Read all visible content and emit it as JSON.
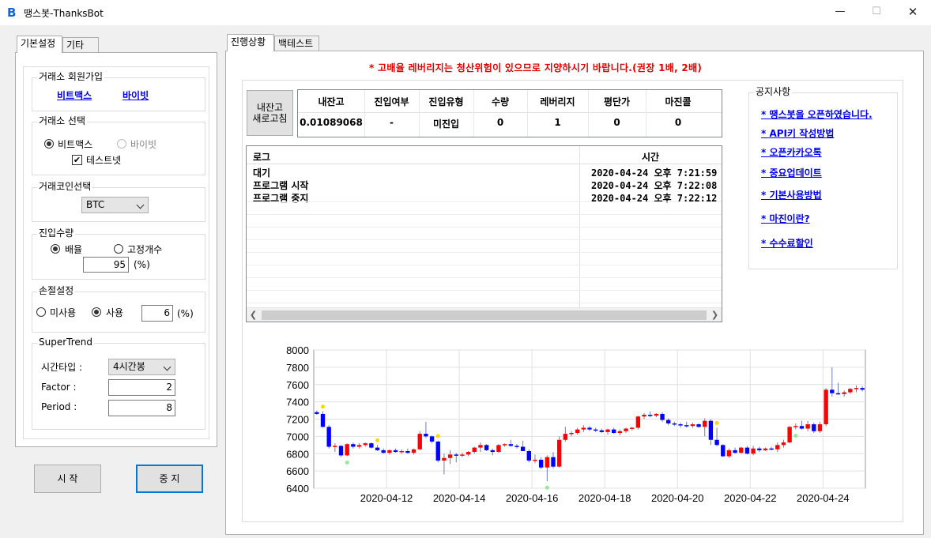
{
  "window": {
    "title": "땡스봇-ThanksBot",
    "icon": "b-logo-icon"
  },
  "left_tabs": [
    "기본설정",
    "기타"
  ],
  "signup": {
    "title": "거래소 회원가입",
    "link1": "비트맥스",
    "link2": "바이빗"
  },
  "exchange": {
    "title": "거래소 선택",
    "opt1": "비트맥스",
    "opt2": "바이빗",
    "testnet": "테스트넷",
    "selected": "비트맥스",
    "testnet_checked": true
  },
  "coin": {
    "title": "거래코인선택",
    "value": "BTC"
  },
  "qty": {
    "title": "진입수량",
    "opt1": "배율",
    "opt2": "고정개수",
    "value": "95",
    "unit": "(%)",
    "selected": "배율"
  },
  "stoploss": {
    "title": "손절설정",
    "opt1": "미사용",
    "opt2": "사용",
    "value": "6",
    "unit": "(%)",
    "selected": "사용"
  },
  "supertrend": {
    "title": "SuperTrend",
    "timeframe_label": "시간타입 :",
    "timeframe_value": "4시간봉",
    "factor_label": "Factor :",
    "factor_value": "2",
    "period_label": "Period :",
    "period_value": "8"
  },
  "buttons": {
    "start": "시 작",
    "stop": "중 지"
  },
  "right_tabs": [
    "진행상황",
    "백테스트"
  ],
  "warning": "* 고배율 레버리지는 청산위험이 있으므로 지양하시기 바랍니다.(권장 1배, 2배)",
  "refresh_button": "내잔고\n새로고침",
  "status_table": {
    "headers": [
      "내잔고",
      "진입여부",
      "진입유형",
      "수량",
      "레버리지",
      "평단가",
      "마진콜"
    ],
    "values": [
      "0.01089068",
      "-",
      "미진입",
      "0",
      "1",
      "0",
      "0"
    ]
  },
  "log": {
    "headers": [
      "로그",
      "시간"
    ],
    "rows": [
      [
        "대기",
        "2020-04-24 오후 7:21:59"
      ],
      [
        "프로그램 시작",
        "2020-04-24 오후 7:22:08"
      ],
      [
        "프로그램 중지",
        "2020-04-24 오후 7:22:12"
      ]
    ]
  },
  "notices": {
    "title": "공지사항",
    "items": [
      "* 땡스봇을 오픈하였습니다.",
      "* API키 작성방법",
      "* 오픈카카오톡",
      "* 중요업데이트",
      "* 기본사용방법",
      "* 마진이란?",
      "* 수수료할인"
    ]
  },
  "colors": {
    "up": "#ff0000",
    "down": "#0000ff",
    "buy_marker": "#90ee90",
    "sell_marker": "#ffd700",
    "link": "#0000ee",
    "warning": "#e00000"
  },
  "chart_data": {
    "type": "candlestick",
    "ylim": [
      6400,
      8000
    ],
    "yticks": [
      6400,
      6600,
      6800,
      7000,
      7200,
      7400,
      7600,
      7800,
      8000
    ],
    "xticks": [
      "2020-04-12",
      "2020-04-14",
      "2020-04-16",
      "2020-04-18",
      "2020-04-20",
      "2020-04-22",
      "2020-04-24"
    ],
    "x_start": "2020-04-10T00:00",
    "interval_hours": 4,
    "grid": true,
    "candles": [
      [
        7280,
        7300,
        7250,
        7260
      ],
      [
        7260,
        7290,
        7100,
        7110
      ],
      [
        7110,
        7130,
        6860,
        6880
      ],
      [
        6880,
        6920,
        6820,
        6890
      ],
      [
        6890,
        6900,
        6760,
        6780
      ],
      [
        6780,
        6920,
        6770,
        6910
      ],
      [
        6910,
        6930,
        6860,
        6880
      ],
      [
        6880,
        6920,
        6860,
        6900
      ],
      [
        6900,
        6930,
        6880,
        6920
      ],
      [
        6920,
        6930,
        6860,
        6870
      ],
      [
        6870,
        6900,
        6830,
        6840
      ],
      [
        6840,
        6860,
        6800,
        6810
      ],
      [
        6810,
        6850,
        6790,
        6840
      ],
      [
        6840,
        6860,
        6810,
        6820
      ],
      [
        6820,
        6850,
        6800,
        6830
      ],
      [
        6830,
        6860,
        6800,
        6810
      ],
      [
        6810,
        6860,
        6790,
        6850
      ],
      [
        6850,
        7060,
        6840,
        7030
      ],
      [
        7030,
        7170,
        6980,
        7000
      ],
      [
        7000,
        7010,
        6920,
        6940
      ],
      [
        6940,
        6950,
        6700,
        6720
      ],
      [
        6720,
        6800,
        6560,
        6750
      ],
      [
        6750,
        6840,
        6680,
        6790
      ],
      [
        6790,
        6810,
        6700,
        6780
      ],
      [
        6780,
        6810,
        6760,
        6790
      ],
      [
        6790,
        6830,
        6770,
        6820
      ],
      [
        6820,
        6880,
        6800,
        6870
      ],
      [
        6870,
        6930,
        6820,
        6900
      ],
      [
        6900,
        6910,
        6830,
        6840
      ],
      [
        6840,
        6860,
        6780,
        6820
      ],
      [
        6820,
        6910,
        6810,
        6900
      ],
      [
        6900,
        6920,
        6880,
        6910
      ],
      [
        6910,
        6960,
        6880,
        6890
      ],
      [
        6890,
        6910,
        6860,
        6880
      ],
      [
        6880,
        6950,
        6850,
        6830
      ],
      [
        6830,
        6850,
        6700,
        6720
      ],
      [
        6720,
        6790,
        6690,
        6730
      ],
      [
        6730,
        6760,
        6620,
        6640
      ],
      [
        6640,
        6780,
        6480,
        6760
      ],
      [
        6760,
        6820,
        6630,
        6650
      ],
      [
        6650,
        7000,
        6640,
        6960
      ],
      [
        6960,
        7110,
        6940,
        7030
      ],
      [
        7030,
        7060,
        7000,
        7040
      ],
      [
        7040,
        7100,
        7020,
        7080
      ],
      [
        7080,
        7130,
        7050,
        7100
      ],
      [
        7100,
        7120,
        7060,
        7080
      ],
      [
        7080,
        7100,
        7050,
        7070
      ],
      [
        7070,
        7090,
        7040,
        7050
      ],
      [
        7050,
        7090,
        7020,
        7080
      ],
      [
        7080,
        7100,
        7030,
        7040
      ],
      [
        7040,
        7080,
        7010,
        7060
      ],
      [
        7060,
        7100,
        7040,
        7090
      ],
      [
        7090,
        7110,
        7070,
        7100
      ],
      [
        7100,
        7240,
        7080,
        7230
      ],
      [
        7230,
        7270,
        7200,
        7250
      ],
      [
        7250,
        7290,
        7220,
        7240
      ],
      [
        7240,
        7270,
        7220,
        7260
      ],
      [
        7260,
        7280,
        7170,
        7190
      ],
      [
        7190,
        7210,
        7130,
        7150
      ],
      [
        7150,
        7170,
        7120,
        7140
      ],
      [
        7140,
        7160,
        7100,
        7130
      ],
      [
        7130,
        7170,
        7100,
        7120
      ],
      [
        7120,
        7160,
        7100,
        7140
      ],
      [
        7140,
        7150,
        7100,
        7110
      ],
      [
        7110,
        7210,
        7000,
        7180
      ],
      [
        7180,
        7200,
        6900,
        6960
      ],
      [
        6960,
        7100,
        6890,
        6900
      ],
      [
        6900,
        6910,
        6760,
        6770
      ],
      [
        6770,
        6860,
        6750,
        6840
      ],
      [
        6840,
        6870,
        6800,
        6810
      ],
      [
        6810,
        6880,
        6800,
        6870
      ],
      [
        6870,
        6890,
        6790,
        6800
      ],
      [
        6800,
        6890,
        6780,
        6860
      ],
      [
        6860,
        6880,
        6820,
        6840
      ],
      [
        6840,
        6870,
        6830,
        6860
      ],
      [
        6860,
        6880,
        6840,
        6850
      ],
      [
        6850,
        6930,
        6820,
        6900
      ],
      [
        6900,
        6960,
        6870,
        6930
      ],
      [
        6930,
        7120,
        6920,
        7110
      ],
      [
        7110,
        7150,
        7080,
        7120
      ],
      [
        7120,
        7180,
        7080,
        7090
      ],
      [
        7090,
        7180,
        7060,
        7140
      ],
      [
        7140,
        7160,
        7040,
        7060
      ],
      [
        7060,
        7170,
        7040,
        7140
      ],
      [
        7140,
        7560,
        7120,
        7540
      ],
      [
        7540,
        7800,
        7460,
        7500
      ],
      [
        7500,
        7620,
        7480,
        7490
      ],
      [
        7490,
        7530,
        7460,
        7510
      ],
      [
        7510,
        7560,
        7490,
        7550
      ],
      [
        7550,
        7590,
        7510,
        7560
      ],
      [
        7560,
        7580,
        7520,
        7540
      ]
    ],
    "buy_markers": [
      5,
      38,
      79
    ],
    "sell_markers": [
      1,
      10,
      20,
      66
    ]
  }
}
